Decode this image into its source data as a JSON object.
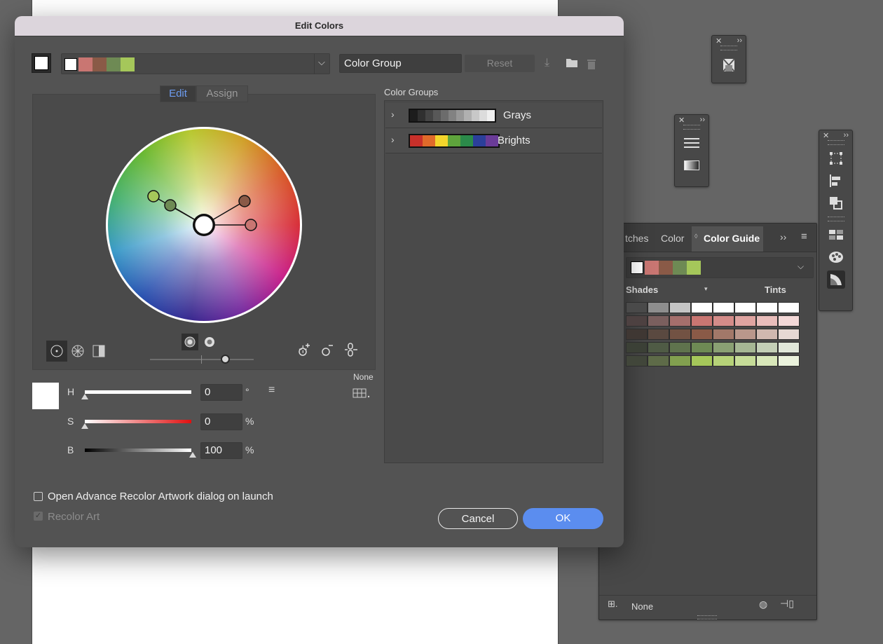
{
  "dialog": {
    "title": "Edit Colors",
    "group_name_value": "Color Group",
    "reset_label": "Reset",
    "active_swatches": [
      "#ffffff",
      "#c97672",
      "#8a5a47",
      "#6e8a54",
      "#a5c75a"
    ],
    "tabs": [
      {
        "label": "Edit",
        "active": true
      },
      {
        "label": "Assign",
        "active": false
      }
    ],
    "wheel_modes": [
      "smooth-color-wheel-icon",
      "segmented-color-wheel-icon",
      "color-bars-icon"
    ],
    "brightness_modes": [
      "show-brightness-icon",
      "show-saturation-icon"
    ],
    "harmony_tools": [
      "add-color-tool-icon",
      "remove-color-tool-icon",
      "link-harmony-colors-icon"
    ],
    "sliders": {
      "h": {
        "letter": "H",
        "value": "0",
        "unit": "°"
      },
      "s": {
        "letter": "S",
        "value": "0",
        "unit": "%"
      },
      "b": {
        "letter": "B",
        "value": "100",
        "unit": "%"
      }
    },
    "limit_label": "None",
    "color_groups_header": "Color Groups",
    "color_groups": [
      {
        "name": "Grays",
        "colors": [
          "#1d1d1d",
          "#303030",
          "#444444",
          "#585858",
          "#6c6c6c",
          "#828282",
          "#989898",
          "#b0b0b0",
          "#c8c8c8",
          "#dcdcdc",
          "#efefef"
        ]
      },
      {
        "name": "Brights",
        "colors": [
          "#c8302a",
          "#e06a2a",
          "#f3d52b",
          "#5ea43c",
          "#2b8a4a",
          "#2b3f9a",
          "#6a3b98"
        ]
      }
    ],
    "open_advance_label": "Open Advance Recolor Artwork dialog on launch",
    "open_advance_checked": false,
    "recolor_art_label": "Recolor Art",
    "recolor_art_checked": true,
    "cancel_label": "Cancel",
    "ok_label": "OK",
    "accent_color": "#5b8def"
  },
  "color_guide_panel": {
    "tabs": [
      {
        "label": "tches"
      },
      {
        "label": "Color"
      },
      {
        "label": "Color Guide",
        "active": true
      }
    ],
    "swatches": [
      "#ffffff",
      "#c97672",
      "#8a5a47",
      "#6e8a54",
      "#a5c75a"
    ],
    "shades_label": "Shades",
    "tints_label": "Tints",
    "grid": [
      [
        "#4a4a4a",
        "#8e8e8e",
        "#c5c5c5",
        "#ffffff",
        "#ffffff",
        "#ffffff",
        "#ffffff",
        "#ffffff"
      ],
      [
        "#4d4141",
        "#7a5f5e",
        "#a56f6c",
        "#c97672",
        "#d48c89",
        "#dfa4a1",
        "#e9bdbb",
        "#f3d8d7"
      ],
      [
        "#3f3733",
        "#5a4940",
        "#725243",
        "#8a5a47",
        "#a27869",
        "#b9978b",
        "#d0b8af",
        "#e6d8d3"
      ],
      [
        "#3b4036",
        "#4f5b45",
        "#5f734d",
        "#6e8a54",
        "#8aa073",
        "#a6b794",
        "#c3cfb6",
        "#e0e7d9"
      ],
      [
        "#41463a",
        "#5e6b48",
        "#82a04f",
        "#a5c75a",
        "#b6d278",
        "#c6dc98",
        "#d8e7b9",
        "#eaf2dc"
      ]
    ],
    "footer_label": "None"
  }
}
